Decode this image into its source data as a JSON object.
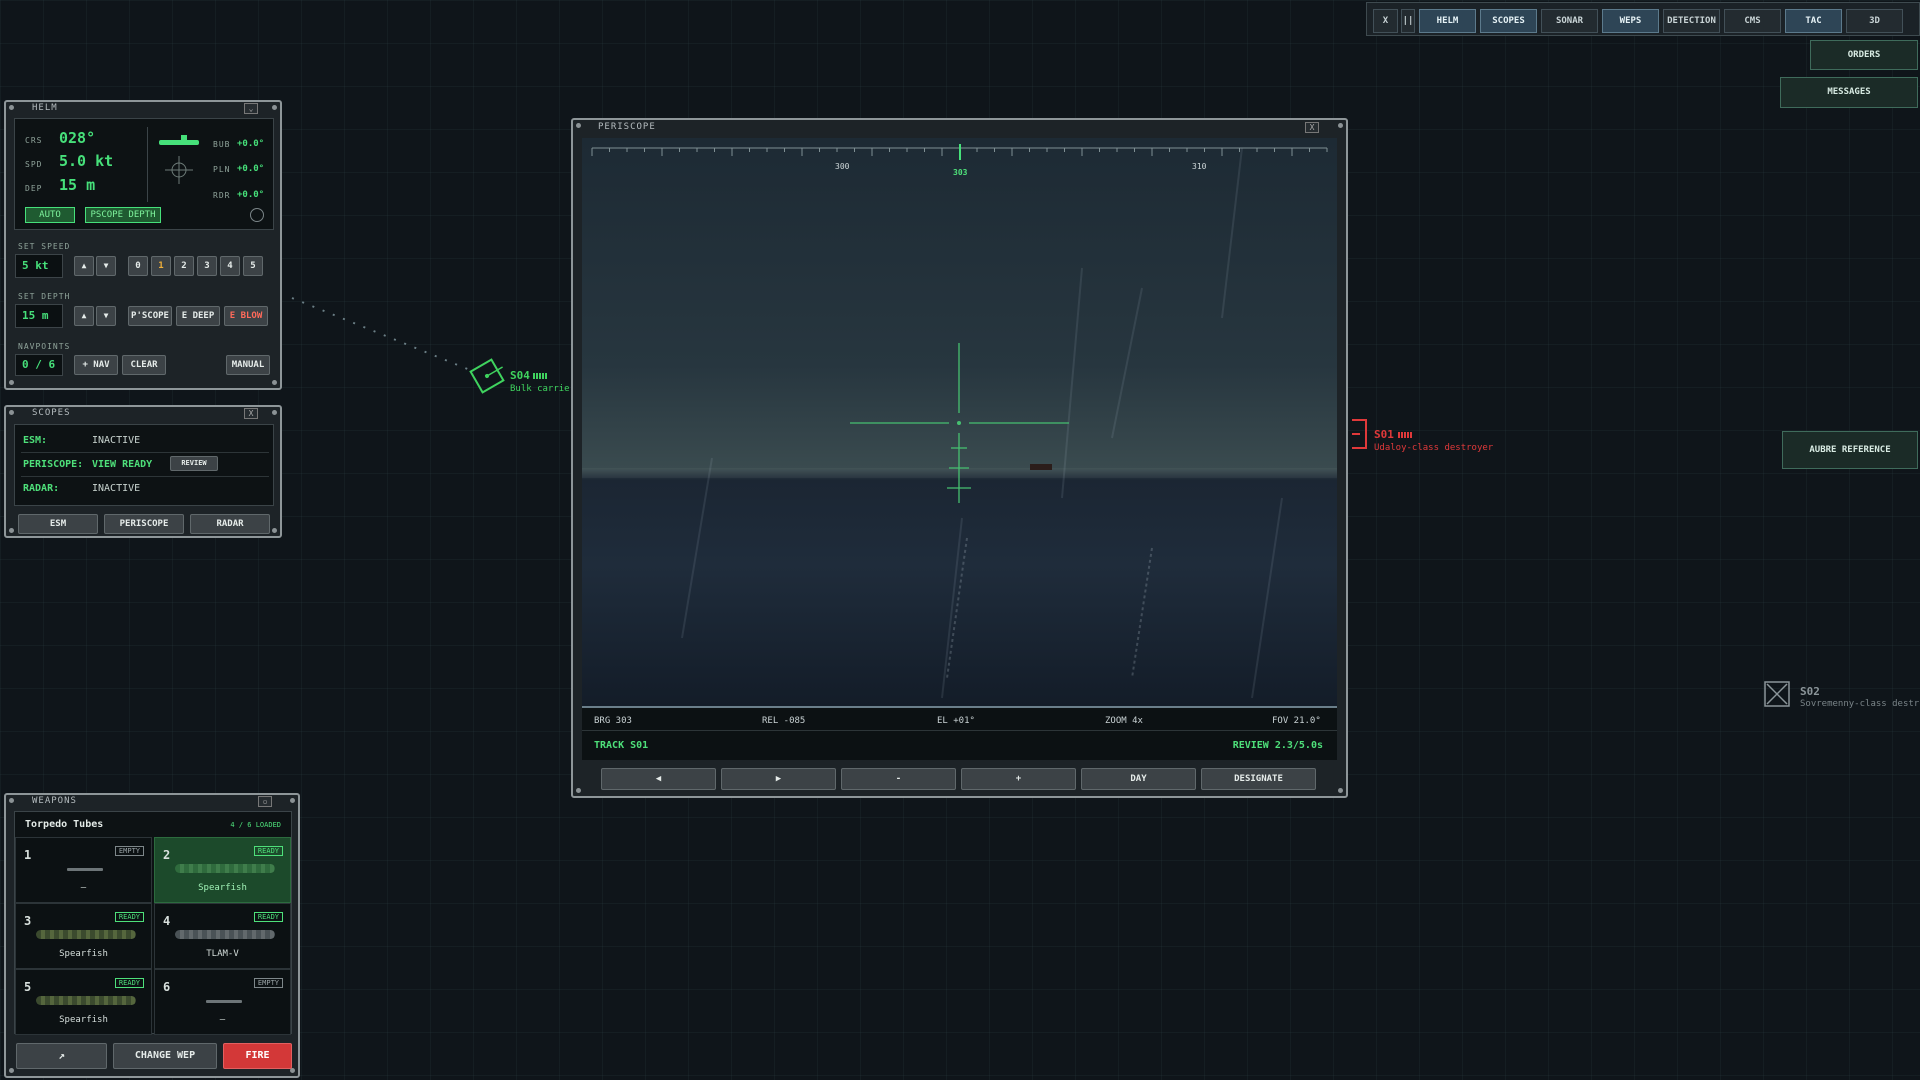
{
  "topbar": {
    "buttons": [
      {
        "label": "X",
        "on": false
      },
      {
        "label": "||",
        "on": false
      },
      {
        "label": "HELM",
        "on": true
      },
      {
        "label": "SCOPES",
        "on": true
      },
      {
        "label": "SONAR",
        "on": false
      },
      {
        "label": "WEPS",
        "on": true
      },
      {
        "label": "DETECTION",
        "on": false
      },
      {
        "label": "CMS",
        "on": false
      },
      {
        "label": "TAC",
        "on": true
      },
      {
        "label": "3D",
        "on": false
      }
    ],
    "orders": "ORDERS",
    "messages": "MESSAGES",
    "aubre_reference": "AUBRE  REFERENCE"
  },
  "helm": {
    "title": "HELM",
    "crs_label": "CRS",
    "crs": "028°",
    "spd_label": "SPD",
    "spd": "5.0 kt",
    "dep_label": "DEP",
    "dep": "15 m",
    "bub_label": "BUB",
    "bub": "+0.0°",
    "pln_label": "PLN",
    "pln": "+0.0°",
    "rdr_label": "RDR",
    "rdr": "+0.0°",
    "auto": "AUTO",
    "pscope_depth": "PSCOPE DEPTH",
    "set_speed_label": "SET SPEED",
    "set_speed": "5 kt",
    "speed_steps": [
      "0",
      "1",
      "2",
      "3",
      "4",
      "5"
    ],
    "active_step": "1",
    "set_depth_label": "SET DEPTH",
    "set_depth": "15 m",
    "pscope_btn": "P'SCOPE",
    "edeep_btn": "E DEEP",
    "eblow_btn": "E BLOW",
    "navpoints_label": "NAVPOINTS",
    "navpoints": "0 / 6",
    "add_nav": "+ NAV",
    "clear": "CLEAR",
    "manual": "MANUAL",
    "up": "▲",
    "down": "▼"
  },
  "scopes": {
    "title": "SCOPES",
    "close": "X",
    "esm_label": "ESM:",
    "esm": "INACTIVE",
    "periscope_label": "PERISCOPE:",
    "periscope": "VIEW READY",
    "review": "REVIEW",
    "radar_label": "RADAR:",
    "radar": "INACTIVE",
    "btn_esm": "ESM",
    "btn_periscope": "PERISCOPE",
    "btn_radar": "RADAR"
  },
  "periscope": {
    "title": "PERISCOPE",
    "close": "X",
    "bearing_ticks": [
      "300",
      "303",
      "310"
    ],
    "brg": "BRG 303",
    "rel": "REL -085",
    "el": "EL +01°",
    "zoom": "ZOOM 4x",
    "fov": "FOV 21.0°",
    "track": "TRACK S01",
    "review": "REVIEW 2.3/5.0s",
    "controls": [
      "◀",
      "▶",
      "-",
      "+",
      "DAY",
      "DESIGNATE"
    ]
  },
  "contacts": {
    "s04": {
      "id": "S04",
      "desc": "Bulk carrier",
      "color": "#3fd35e"
    },
    "s01": {
      "id": "S01",
      "desc": "Udaloy-class destroyer",
      "color": "#e0393a"
    },
    "s02": {
      "id": "S02",
      "desc": "Sovremenny-class destr"
    }
  },
  "weapons": {
    "title": "WEAPONS",
    "header": "Torpedo Tubes",
    "loaded": "4 / 6 LOADED",
    "tubes": [
      {
        "num": "1",
        "status": "EMPTY",
        "name": "—"
      },
      {
        "num": "2",
        "status": "READY",
        "name": "Spearfish"
      },
      {
        "num": "3",
        "status": "READY",
        "name": "Spearfish"
      },
      {
        "num": "4",
        "status": "READY",
        "name": "TLAM-V"
      },
      {
        "num": "5",
        "status": "READY",
        "name": "Spearfish"
      },
      {
        "num": "6",
        "status": "EMPTY",
        "name": "—"
      }
    ],
    "arrow_btn": "↗",
    "change_wep": "CHANGE WEP",
    "fire": "FIRE"
  }
}
